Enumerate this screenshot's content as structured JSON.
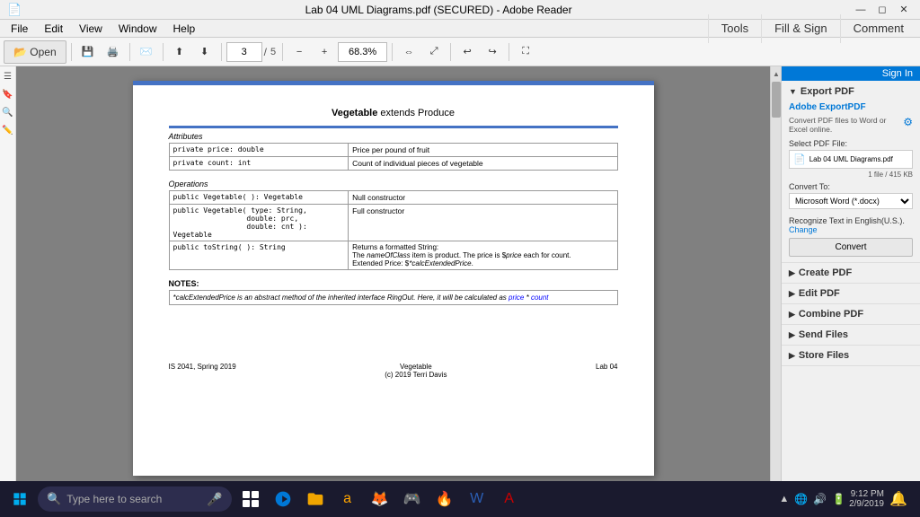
{
  "titlebar": {
    "title": "Lab 04 UML Diagrams.pdf (SECURED) - Adobe Reader",
    "app_name": "Adobe Reader"
  },
  "menubar": {
    "items": [
      "File",
      "Edit",
      "View",
      "Window",
      "Help"
    ]
  },
  "toolbar": {
    "open_label": "Open",
    "page_current": "3",
    "page_total": "5",
    "zoom_value": "68.3%"
  },
  "right_tabs": {
    "tools": "Tools",
    "fill_sign": "Fill & Sign",
    "comment": "Comment"
  },
  "right_panel": {
    "sign_in": "Sign In",
    "export_pdf": "Export PDF",
    "adobe_export": {
      "title": "Adobe ExportPDF",
      "description": "Convert PDF files to Word or Excel online.",
      "settings_icon": "gear-icon"
    },
    "select_pdf_label": "Select PDF File:",
    "file": {
      "name": "Lab 04 UML Diagrams.pdf",
      "info": "1 file / 415 KB"
    },
    "convert_to_label": "Convert To:",
    "convert_option": "Microsoft Word (*.docx)",
    "recognize_label": "Recognize Text in English(U.S.).",
    "change_link": "Change",
    "convert_button": "Convert",
    "sections": [
      {
        "label": "Create PDF",
        "collapsed": true
      },
      {
        "label": "Edit PDF",
        "collapsed": true
      },
      {
        "label": "Combine PDF",
        "collapsed": true
      },
      {
        "label": "Send Files",
        "collapsed": true
      },
      {
        "label": "Store Files",
        "collapsed": true
      }
    ]
  },
  "pdf": {
    "title": "Vegetable extends Produce",
    "attributes_label": "Attributes",
    "attributes": [
      {
        "modifier": "private price: double",
        "description": "Price per pound of fruit"
      },
      {
        "modifier": "private count: int",
        "description": "Count of individual pieces of vegetable"
      }
    ],
    "operations_label": "Operations",
    "operations": [
      {
        "signature": "public Vegetable( ): Vegetable",
        "description": "Null constructor"
      },
      {
        "signature": "public Vegetable( type: String,\n                 double: prc,\n                 double: cnt ):\nVegetable",
        "description": "Full constructor"
      },
      {
        "signature": "public toString( ): String",
        "description": "Returns a formatted String:\nThe nameOfClass item is product. The price is $price each for count.\nExtended Price: $*calcExtendedPrice."
      }
    ],
    "notes_label": "NOTES:",
    "notes_text": "*calcExtendedPrice is an abstract method of the inherited interface RingOut. Here, it will be calculated as price * count",
    "footer_left": "IS 2041, Spring 2019",
    "footer_center": "Vegetable\n(c) 2019 Terri Davis",
    "footer_right": "Lab 04"
  },
  "taskbar": {
    "search_placeholder": "Type here to search",
    "time": "9:12 PM",
    "date": "2/9/2019"
  }
}
